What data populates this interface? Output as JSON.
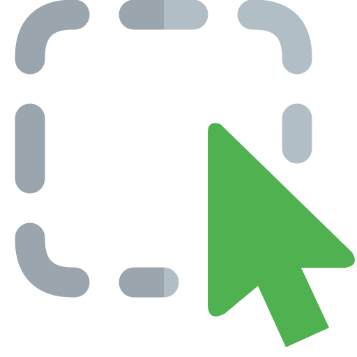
{
  "icon": {
    "name": "select-area-cursor-icon",
    "colors": {
      "dash_dark": "#9aa5ad",
      "dash_light": "#b2bec5",
      "cursor": "#4fb150"
    }
  }
}
